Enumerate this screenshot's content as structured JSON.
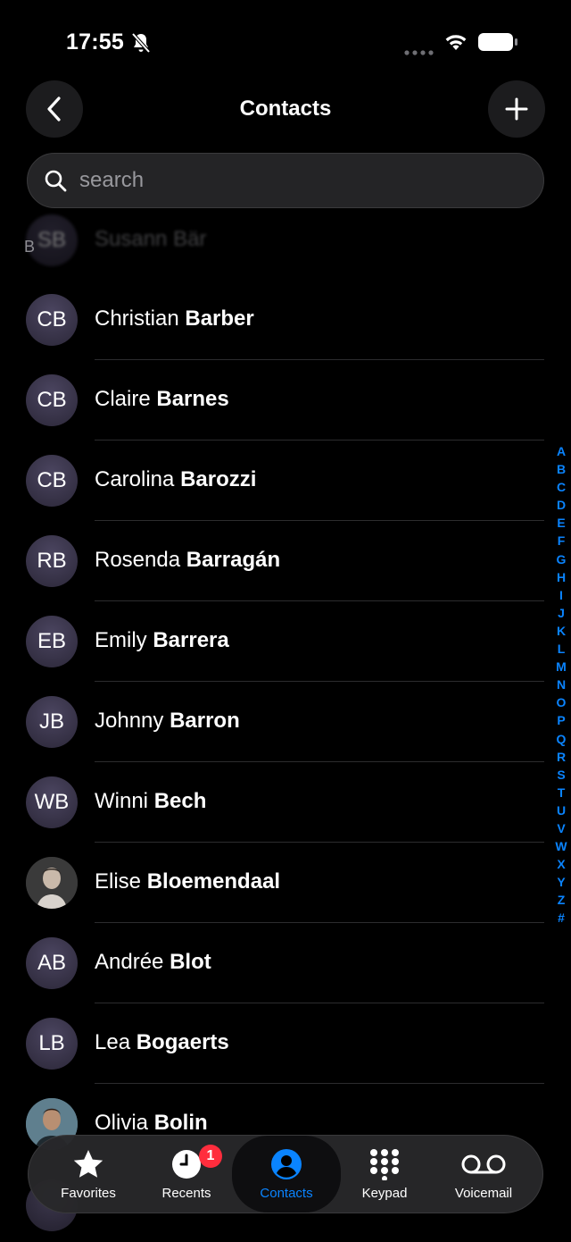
{
  "status": {
    "time": "17:55"
  },
  "nav": {
    "title": "Contacts"
  },
  "search": {
    "placeholder": "search"
  },
  "faded": {
    "initials": "SB",
    "name": "Susann Bär",
    "section_letter": "B"
  },
  "contacts": [
    {
      "initials": "CB",
      "first": "Christian",
      "last": "Barber",
      "photo": false
    },
    {
      "initials": "CB",
      "first": "Claire",
      "last": "Barnes",
      "photo": false
    },
    {
      "initials": "CB",
      "first": "Carolina",
      "last": "Barozzi",
      "photo": false
    },
    {
      "initials": "RB",
      "first": "Rosenda",
      "last": "Barragán",
      "photo": false
    },
    {
      "initials": "EB",
      "first": "Emily",
      "last": "Barrera",
      "photo": false
    },
    {
      "initials": "JB",
      "first": "Johnny",
      "last": "Barron",
      "photo": false
    },
    {
      "initials": "WB",
      "first": "Winni",
      "last": "Bech",
      "photo": false
    },
    {
      "initials": "",
      "first": "Elise",
      "last": "Bloemendaal",
      "photo": true
    },
    {
      "initials": "AB",
      "first": "Andrée",
      "last": "Blot",
      "photo": false
    },
    {
      "initials": "LB",
      "first": "Lea",
      "last": "Bogaerts",
      "photo": false
    },
    {
      "initials": "",
      "first": "Olivia",
      "last": "Bolin",
      "photo": true
    }
  ],
  "index_letters": [
    "A",
    "B",
    "C",
    "D",
    "E",
    "F",
    "G",
    "H",
    "I",
    "J",
    "K",
    "L",
    "M",
    "N",
    "O",
    "P",
    "Q",
    "R",
    "S",
    "T",
    "U",
    "V",
    "W",
    "X",
    "Y",
    "Z",
    "#"
  ],
  "tabs": {
    "favorites": "Favorites",
    "recents": "Recents",
    "contacts": "Contacts",
    "keypad": "Keypad",
    "voicemail": "Voicemail",
    "recents_badge": "1"
  },
  "colors": {
    "accent": "#0a84ff",
    "badge": "#ff2d3d",
    "background": "#000000"
  }
}
